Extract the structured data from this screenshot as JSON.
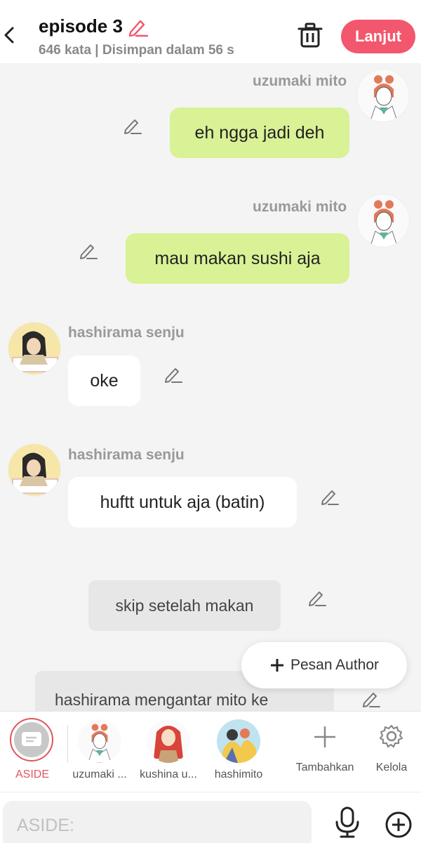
{
  "header": {
    "title": "episode 3",
    "subtitle": "646 kata | Disimpan dalam 56 s",
    "next_label": "Lanjut"
  },
  "messages": [
    {
      "speaker": "uzumaki mito",
      "text": "eh ngga jadi deh",
      "side": "right"
    },
    {
      "speaker": "uzumaki mito",
      "text": "mau makan sushi aja",
      "side": "right"
    },
    {
      "speaker": "hashirama senju",
      "text": "oke",
      "side": "left"
    },
    {
      "speaker": "hashirama senju",
      "text": "huftt untuk aja (batin)",
      "side": "left"
    },
    {
      "speaker": "",
      "text": "skip setelah makan",
      "side": "aside"
    },
    {
      "speaker": "",
      "text": "hashirama mengantar mito ke",
      "side": "aside"
    }
  ],
  "floating_button": {
    "label": "Pesan Author"
  },
  "characters": {
    "aside_label": "ASIDE",
    "items": [
      {
        "label": "uzumaki ..."
      },
      {
        "label": "kushina u..."
      },
      {
        "label": "hashimito"
      }
    ],
    "add_label": "Tambahkan",
    "manage_label": "Kelola"
  },
  "composer": {
    "placeholder": "ASIDE:"
  },
  "colors": {
    "accent": "#f2576d",
    "my_bubble": "#d9f296",
    "aside_bubble": "#e7e7e7"
  }
}
